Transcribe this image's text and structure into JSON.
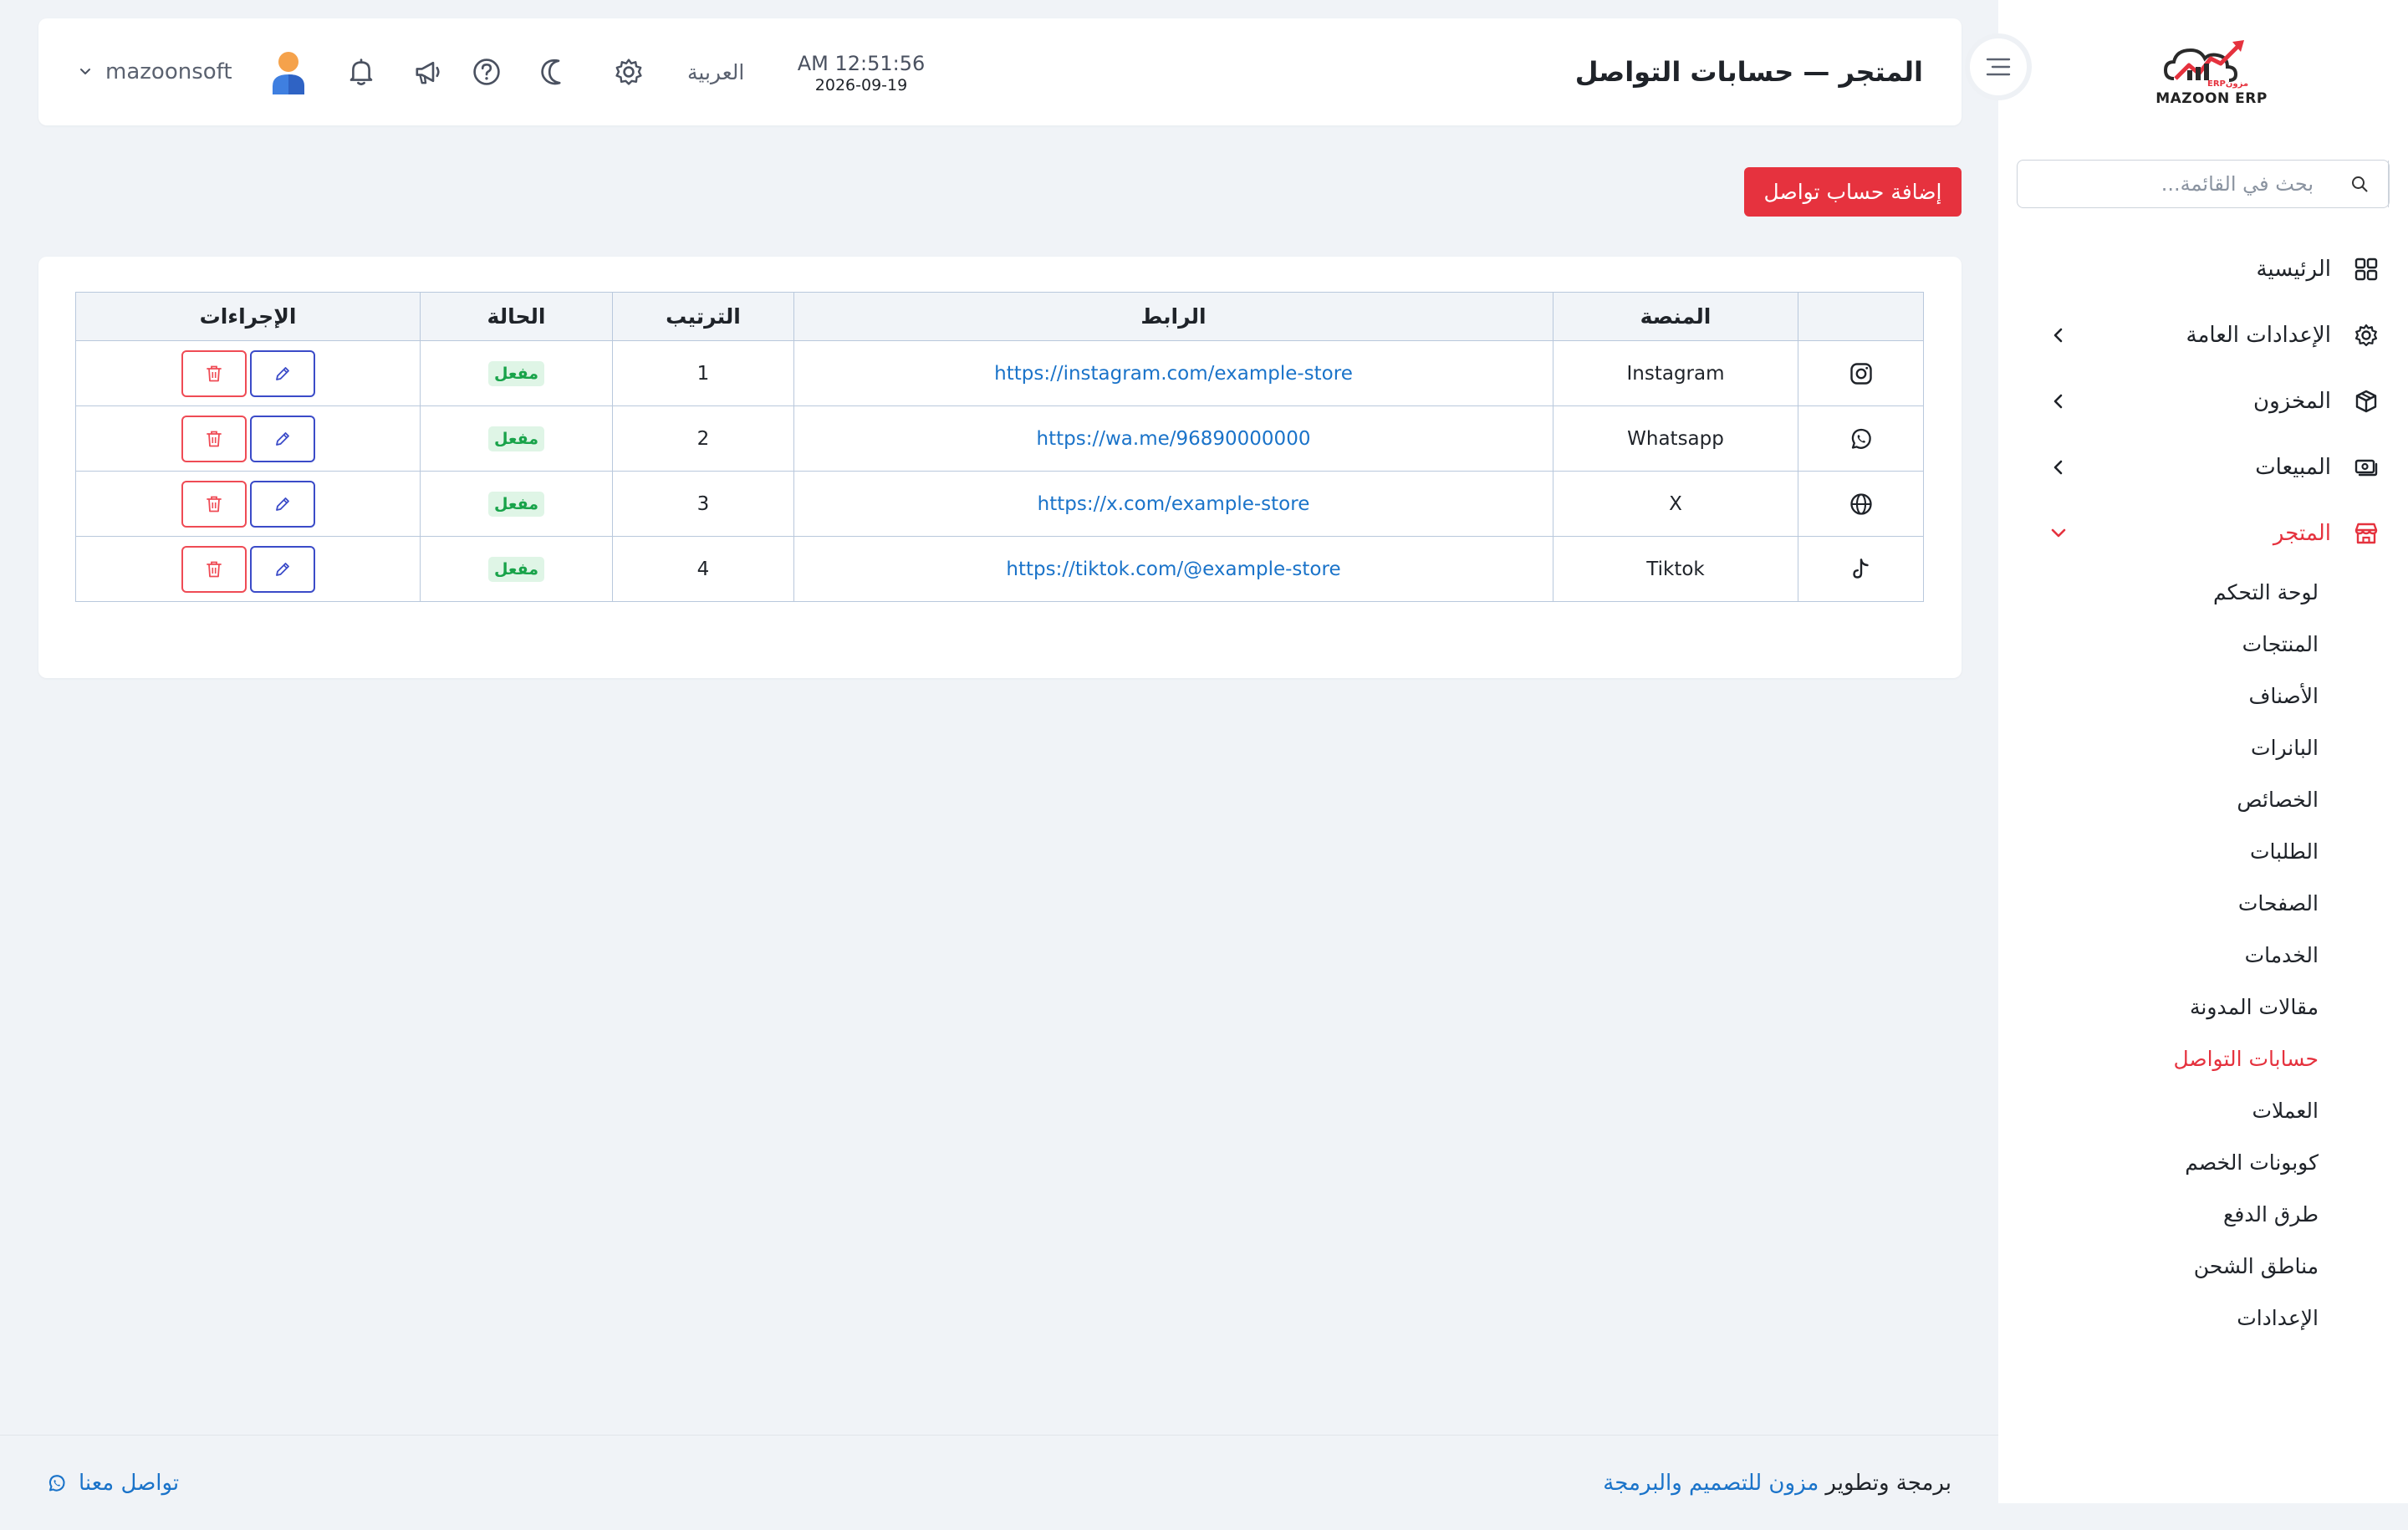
{
  "sidebar": {
    "logo_text": "MAZOON ERP",
    "logo_sub": "ERPمزون",
    "search_placeholder": "بحث في القائمة...",
    "items": [
      {
        "label": "الرئيسية",
        "icon": "grid-icon",
        "has_children": false
      },
      {
        "label": "الإعدادات العامة",
        "icon": "gear-icon",
        "has_children": true
      },
      {
        "label": "المخزون",
        "icon": "box-icon",
        "has_children": true
      },
      {
        "label": "المبيعات",
        "icon": "cash-icon",
        "has_children": true
      },
      {
        "label": "المتجر",
        "icon": "store-icon",
        "has_children": true,
        "expanded": true
      }
    ],
    "store_subitems": [
      "لوحة التحكم",
      "المنتجات",
      "الأصناف",
      "البانرات",
      "الخصائص",
      "الطلبات",
      "الصفحات",
      "الخدمات",
      "مقالات المدونة",
      "حسابات التواصل",
      "العملات",
      "كوبونات الخصم",
      "طرق الدفع",
      "مناطق الشحن",
      "الإعدادات"
    ],
    "active_subitem_index": 9
  },
  "header": {
    "title": "المتجر — حسابات التواصل",
    "time": "AM 12:51:56",
    "date": "2026-09-19",
    "language": "العربية",
    "username": "mazoonsoft"
  },
  "toolbar": {
    "add_label": "إضافة حساب تواصل"
  },
  "table": {
    "headers": {
      "icon": "",
      "platform": "المنصة",
      "link": "الرابط",
      "order": "الترتيب",
      "status": "الحالة",
      "actions": "الإجراءات"
    },
    "rows": [
      {
        "icon": "instagram-icon",
        "platform": "Instagram",
        "link": "https://instagram.com/example-store",
        "order": "1",
        "status": "مفعل"
      },
      {
        "icon": "whatsapp-icon",
        "platform": "Whatsapp",
        "link": "https://wa.me/96890000000",
        "order": "2",
        "status": "مفعل"
      },
      {
        "icon": "globe-icon",
        "platform": "X",
        "link": "https://x.com/example-store",
        "order": "3",
        "status": "مفعل"
      },
      {
        "icon": "tiktok-icon",
        "platform": "Tiktok",
        "link": "https://tiktok.com/@example-store",
        "order": "4",
        "status": "مفعل"
      }
    ]
  },
  "footer": {
    "credit_prefix": "برمجة وتطوير",
    "credit_link": "مزون للتصميم والبرمجة",
    "contact": "تواصل معنا"
  },
  "colors": {
    "accent": "#e6323e",
    "link": "#1a73c9",
    "success_bg": "#dff5e6",
    "success_text": "#19a34a",
    "page_bg": "#f0f3f7"
  }
}
